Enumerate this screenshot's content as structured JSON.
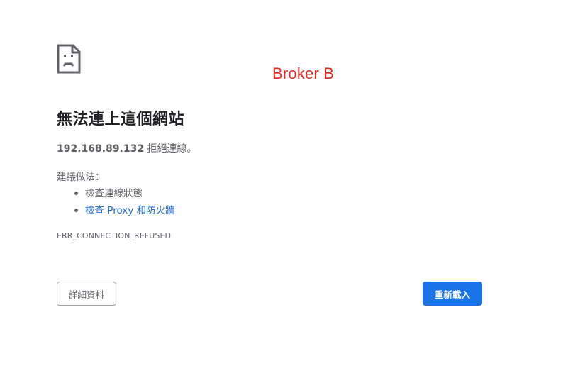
{
  "annotation": {
    "text": "Broker B",
    "color": "#e8281e"
  },
  "icon": {
    "name": "sad-page-icon"
  },
  "error_page": {
    "title": "無法連上這個網站",
    "host": "192.168.89.132",
    "message_suffix": " 拒絕連線。",
    "suggestions_label": "建議做法：",
    "suggestions": [
      {
        "text": "檢查連線狀態",
        "link": false
      },
      {
        "text": "檢查 Proxy 和防火牆",
        "link": true
      }
    ],
    "error_code": "ERR_CONNECTION_REFUSED"
  },
  "buttons": {
    "details_label": "詳細資料",
    "reload_label": "重新載入"
  },
  "colors": {
    "text": "#5f6368",
    "title": "#202124",
    "link": "#1967d2",
    "primary": "#1a73e8"
  }
}
